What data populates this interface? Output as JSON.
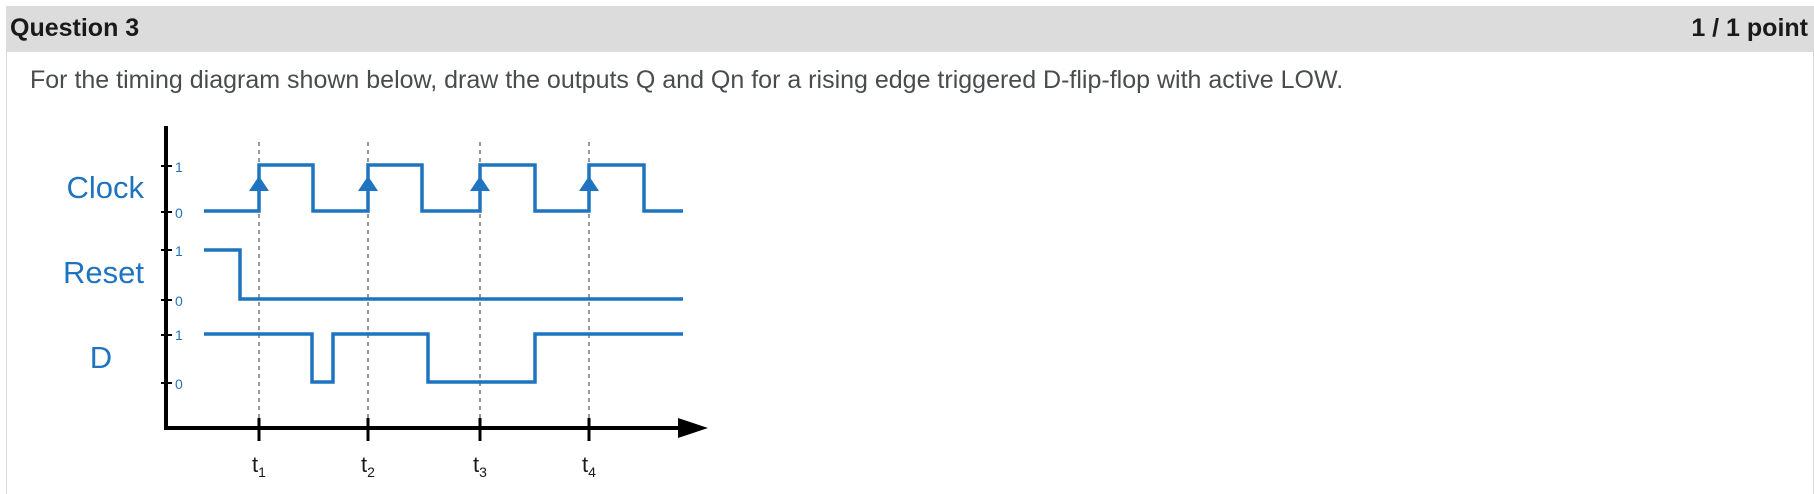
{
  "question": {
    "title": "Question 3",
    "points": "1 / 1 point",
    "prompt": "For the timing diagram shown below, draw the outputs Q and Qn for a rising edge triggered D-flip-flop with active LOW."
  },
  "diagram": {
    "signals": [
      {
        "name": "Clock",
        "high_label": "1",
        "low_label": "0"
      },
      {
        "name": "Reset",
        "high_label": "1",
        "low_label": "0"
      },
      {
        "name": "D",
        "high_label": "1",
        "low_label": "0"
      }
    ],
    "time_markers": [
      {
        "base": "t",
        "sub": "1"
      },
      {
        "base": "t",
        "sub": "2"
      },
      {
        "base": "t",
        "sub": "3"
      },
      {
        "base": "t",
        "sub": "4"
      }
    ],
    "colors": {
      "signal": "#1f74c0",
      "axis": "#000000"
    }
  }
}
